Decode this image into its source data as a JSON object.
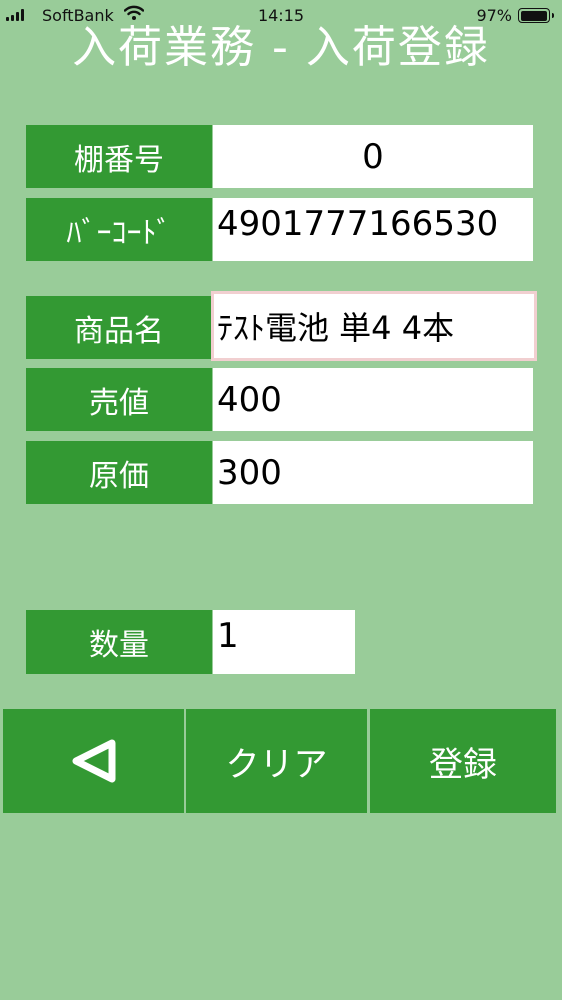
{
  "status_bar": {
    "carrier": "SoftBank",
    "time": "14:15",
    "battery_percent": "97%",
    "battery_level": 0.97,
    "icons": [
      "signal-icon",
      "wifi-icon",
      "battery-icon"
    ]
  },
  "header": {
    "title": "入荷業務 - 入荷登録"
  },
  "form": {
    "shelf": {
      "label": "棚番号",
      "value": "0"
    },
    "barcode": {
      "label": "ﾊﾞｰｺｰﾄﾞ",
      "value": "4901777166530"
    },
    "product": {
      "label": "商品名",
      "value": "ﾃｽﾄ電池 単4 4本"
    },
    "price": {
      "label": "売値",
      "value": "400"
    },
    "cost": {
      "label": "原価",
      "value": "300"
    },
    "quantity": {
      "label": "数量",
      "value": "1"
    }
  },
  "buttons": {
    "back_icon": "back-triangle-icon",
    "clear_label": "クリア",
    "register_label": "登録"
  },
  "colors": {
    "background": "#99cc99",
    "accent": "#339933",
    "field_bg": "#ffffff",
    "focus_border": "#f1cfd0"
  }
}
